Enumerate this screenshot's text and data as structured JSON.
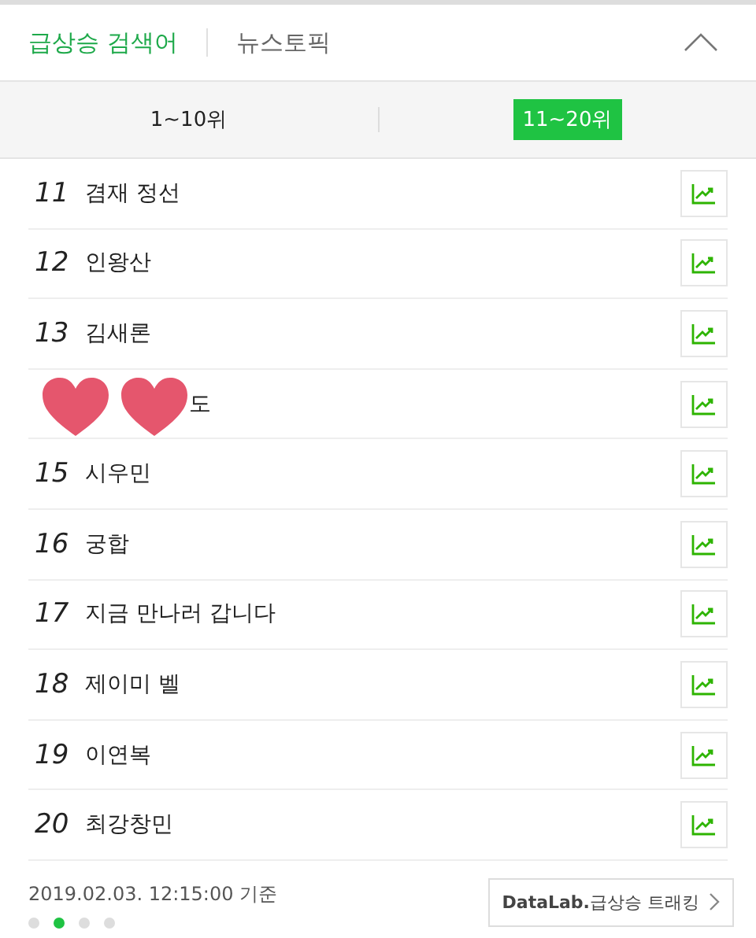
{
  "header_tabs": [
    {
      "label": "급상승 검색어",
      "selected": true
    },
    {
      "label": "뉴스토픽",
      "selected": false
    }
  ],
  "range_tabs": [
    {
      "label": "1~10위",
      "selected": false
    },
    {
      "label": "11~20위",
      "selected": true
    }
  ],
  "rows": [
    {
      "rank": "11",
      "name": "겸재 정선"
    },
    {
      "rank": "12",
      "name": "인왕산"
    },
    {
      "rank": "13",
      "name": "김새론"
    },
    {
      "name": "도",
      "stickers": true
    },
    {
      "rank": "15",
      "name": "시우민"
    },
    {
      "rank": "16",
      "name": "궁합"
    },
    {
      "rank": "17",
      "name": "지금 만나러 갑니다"
    },
    {
      "rank": "18",
      "name": "제이미 벨"
    },
    {
      "rank": "19",
      "name": "이연복"
    },
    {
      "rank": "20",
      "name": "최강창민"
    }
  ],
  "timestamp": "2019.02.03. 12:15:00 기준",
  "datalab_button": "**DataLab.**급상승 트래킹",
  "pages": [
    {
      "selected": false
    },
    {
      "selected": true
    },
    {
      "selected": false
    },
    {
      "selected": false
    }
  ]
}
